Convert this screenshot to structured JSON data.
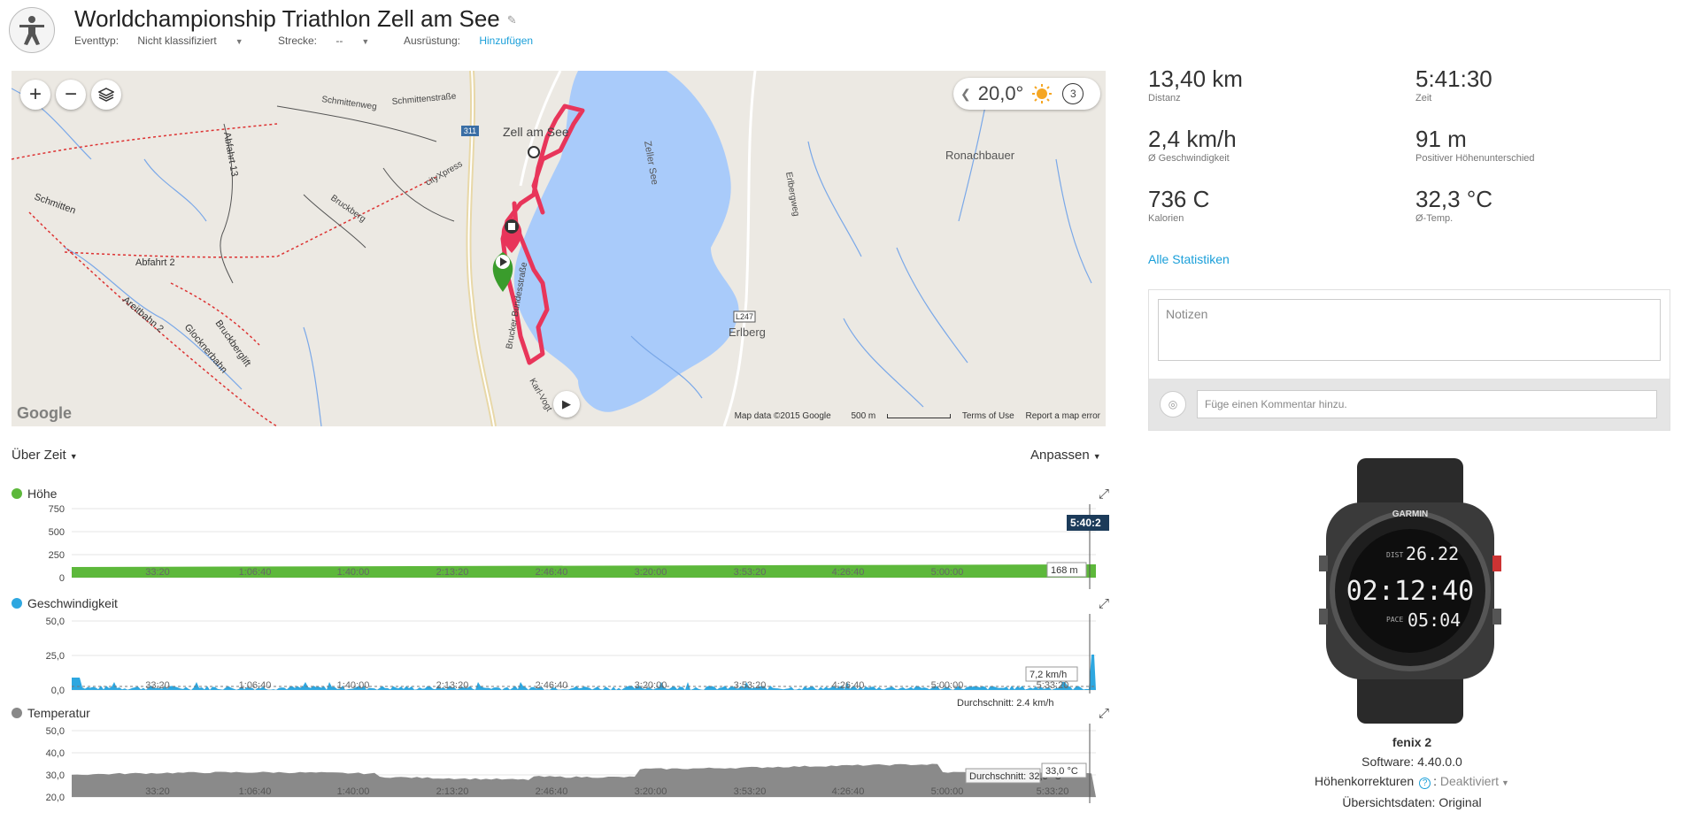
{
  "activity": {
    "title": "Worldchampionship Triathlon Zell am See",
    "event_type_label": "Eventtyp:",
    "event_type_value": "Nicht klassifiziert",
    "course_label": "Strecke:",
    "course_value": "--",
    "gear_label": "Ausrüstung:",
    "gear_value": "Hinzufügen"
  },
  "map": {
    "zoom_in": "+",
    "zoom_out": "−",
    "weather_temp": "20,0°",
    "weather_badge": "3",
    "place_labels": [
      "Zell am See",
      "Zeller See",
      "Ronachbauer",
      "Erlberg",
      "Abfahrt 2",
      "Schmitten",
      "Areitbahn 2",
      "Glocknerbahn",
      "Bruckberglift",
      "Schmittenweg",
      "Schmittenstraße",
      "cityXpress",
      "Abfahrt 13",
      "Bruckberg",
      "Erlbergweg",
      "Brucker Bundesstraße",
      "Karl-Vogt",
      "311",
      "L247"
    ],
    "footer_data": "Map data ©2015 Google",
    "footer_scale": "500 m",
    "footer_terms": "Terms of Use",
    "footer_report": "Report a map error",
    "logo": "Google"
  },
  "chart_controls": {
    "time_selector": "Über Zeit",
    "customize": "Anpassen"
  },
  "charts": {
    "elevation": {
      "title": "Höhe",
      "color": "#5db83b",
      "yticks": [
        "750",
        "500",
        "250",
        "0"
      ],
      "xticks": [
        "33:20",
        "1:06:40",
        "1:40:00",
        "2:13:20",
        "2:46:40",
        "3:20:00",
        "3:53:20",
        "4:26:40",
        "5:00:00",
        "5:33:20"
      ],
      "cursor_time": "5:40:2",
      "cursor_value": "168 m"
    },
    "speed": {
      "title": "Geschwindigkeit",
      "color": "#2ea7e0",
      "yticks": [
        "50,0",
        "25,0",
        "0,0"
      ],
      "xticks": [
        "33:20",
        "1:06:40",
        "1:40:00",
        "2:13:20",
        "2:46:40",
        "3:20:00",
        "3:53:20",
        "4:26:40",
        "5:00:00",
        "5:33:20"
      ],
      "cursor_value": "7,2 km/h",
      "average": "Durchschnitt: 2.4 km/h"
    },
    "temperature": {
      "title": "Temperatur",
      "color": "#888888",
      "yticks": [
        "50,0",
        "40,0",
        "30,0",
        "20,0"
      ],
      "xticks": [
        "33:20",
        "1:06:40",
        "1:40:00",
        "2:13:20",
        "2:46:40",
        "3:20:00",
        "3:53:20",
        "4:26:40",
        "5:00:00",
        "5:33:20"
      ],
      "cursor_value": "33,0 °C",
      "average": "Durchschnitt: 32,3 °C"
    }
  },
  "stats": [
    {
      "value": "13,40 km",
      "label": "Distanz"
    },
    {
      "value": "5:41:30",
      "label": "Zeit"
    },
    {
      "value": "2,4 km/h",
      "label": "Ø Geschwindigkeit"
    },
    {
      "value": "91 m",
      "label": "Positiver Höhenunterschied"
    },
    {
      "value": "736 C",
      "label": "Kalorien"
    },
    {
      "value": "32,3 °C",
      "label": "Ø-Temp."
    }
  ],
  "all_stats_link": "Alle Statistiken",
  "notes": {
    "placeholder": "Notizen",
    "comment_placeholder": "Füge einen Kommentar hinzu."
  },
  "device": {
    "name": "fenix 2",
    "software_label": "Software:",
    "software_value": "4.40.0.0",
    "altitude_label": "Höhenkorrekturen",
    "altitude_value": "Deaktiviert",
    "summary_label": "Übersichtsdaten:",
    "summary_value": "Original",
    "watch_brand": "GARMIN",
    "watch_dist": "26.22",
    "watch_time": "02:12:40",
    "watch_pace": "05:04"
  }
}
